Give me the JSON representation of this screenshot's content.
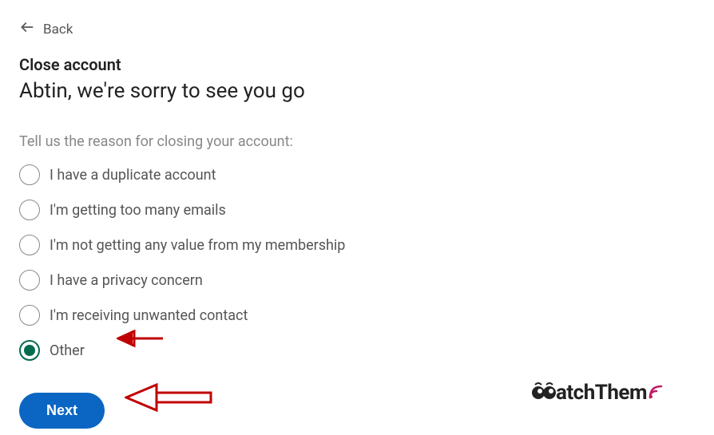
{
  "nav": {
    "back_label": "Back"
  },
  "header": {
    "close_title": "Close account",
    "sorry_title": "Abtin, we're sorry to see you go"
  },
  "prompt": "Tell us the reason for closing your account:",
  "options": [
    {
      "label": "I have a duplicate account",
      "selected": false
    },
    {
      "label": "I'm getting too many emails",
      "selected": false
    },
    {
      "label": "I'm not getting any value from my membership",
      "selected": false
    },
    {
      "label": "I have a privacy concern",
      "selected": false
    },
    {
      "label": "I'm receiving unwanted contact",
      "selected": false
    },
    {
      "label": "Other",
      "selected": true
    }
  ],
  "actions": {
    "next_label": "Next"
  },
  "watermark": {
    "text": "atchThem"
  }
}
